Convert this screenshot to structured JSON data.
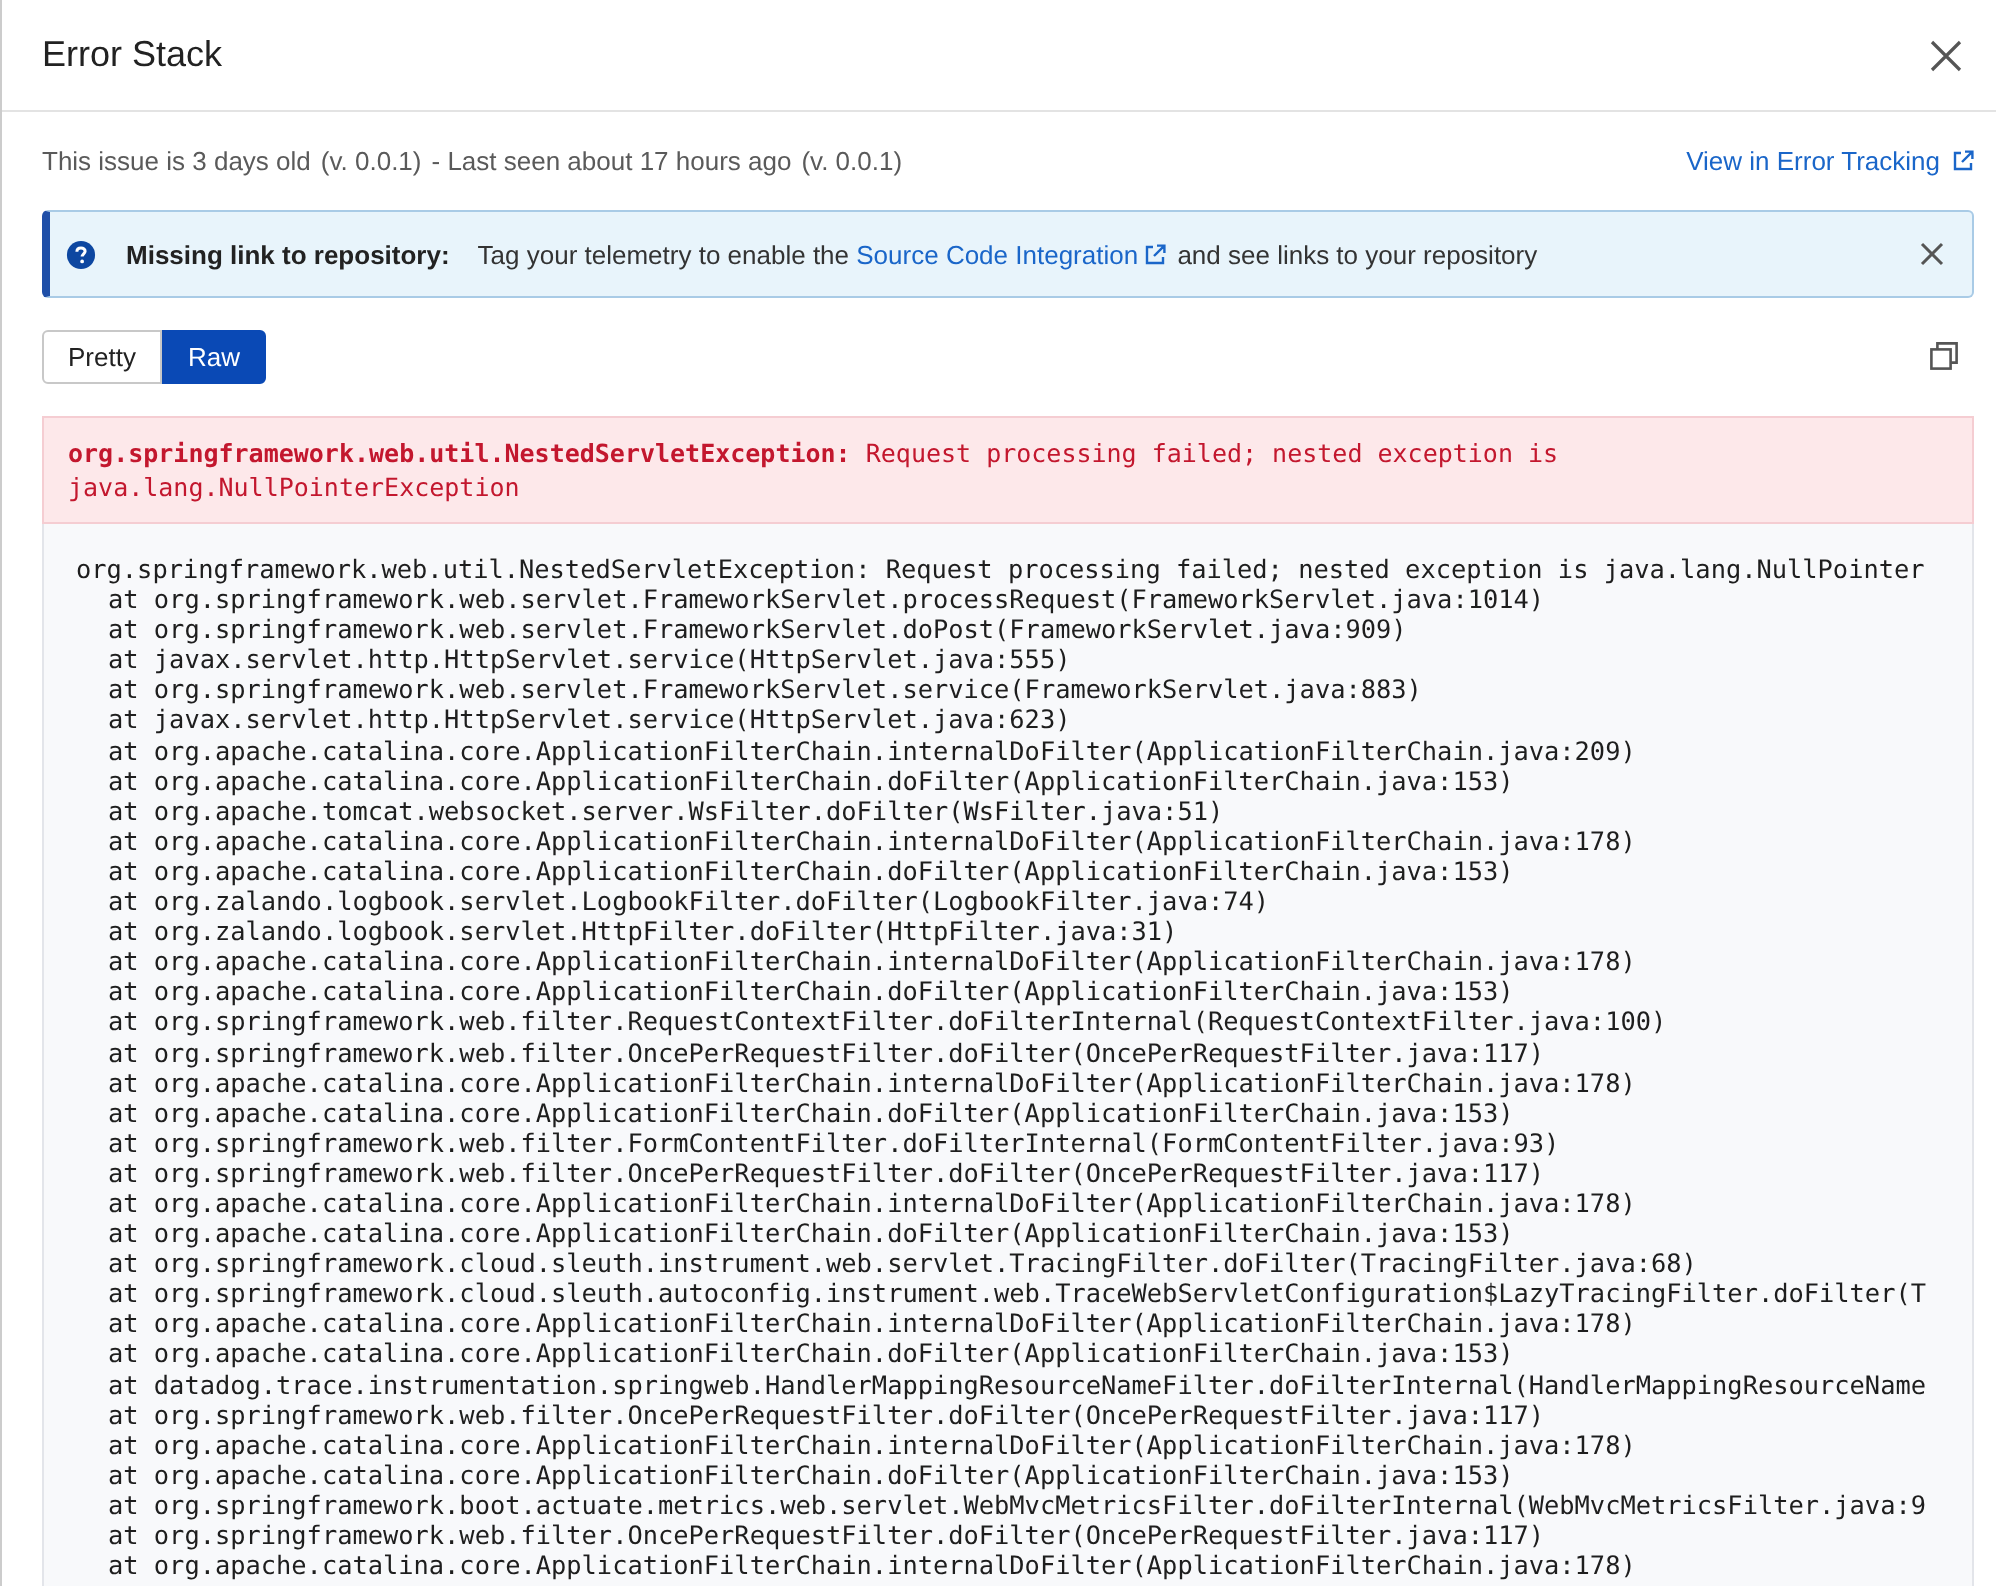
{
  "window": {
    "title": "Error Stack"
  },
  "meta": {
    "age": "This issue is 3 days old",
    "first_version": "(v. 0.0.1)",
    "last_seen": "- Last seen about 17 hours ago",
    "last_version": "(v. 0.0.1)",
    "link": "View in Error Tracking"
  },
  "banner": {
    "label": "Missing link to repository:",
    "text_before": "Tag your telemetry to enable the",
    "link": "Source Code Integration",
    "text_after": "and see links to your repository"
  },
  "view_toggle": [
    {
      "label": "Pretty",
      "selected": false
    },
    {
      "label": "Raw",
      "selected": true
    }
  ],
  "error": {
    "type": "org.springframework.web.util.NestedServletException:",
    "message": "Request processing failed; nested exception is java.lang.NullPointerException"
  },
  "stack_lines": [
    {
      "kind": "exception",
      "text": "org.springframework.web.util.NestedServletException: Request processing failed; nested exception is java.lang.NullPointer"
    },
    {
      "kind": "frame",
      "text": "at org.springframework.web.servlet.FrameworkServlet.processRequest(FrameworkServlet.java:1014)"
    },
    {
      "kind": "frame",
      "text": "at org.springframework.web.servlet.FrameworkServlet.doPost(FrameworkServlet.java:909)"
    },
    {
      "kind": "frame",
      "text": "at javax.servlet.http.HttpServlet.service(HttpServlet.java:555)"
    },
    {
      "kind": "frame",
      "text": "at org.springframework.web.servlet.FrameworkServlet.service(FrameworkServlet.java:883)"
    },
    {
      "kind": "frame",
      "text": "at javax.servlet.http.HttpServlet.service(HttpServlet.java:623)"
    },
    {
      "kind": "frame",
      "text": "at org.apache.catalina.core.ApplicationFilterChain.internalDoFilter(ApplicationFilterChain.java:209)"
    },
    {
      "kind": "frame",
      "text": "at org.apache.catalina.core.ApplicationFilterChain.doFilter(ApplicationFilterChain.java:153)"
    },
    {
      "kind": "frame",
      "text": "at org.apache.tomcat.websocket.server.WsFilter.doFilter(WsFilter.java:51)"
    },
    {
      "kind": "frame",
      "text": "at org.apache.catalina.core.ApplicationFilterChain.internalDoFilter(ApplicationFilterChain.java:178)"
    },
    {
      "kind": "frame",
      "text": "at org.apache.catalina.core.ApplicationFilterChain.doFilter(ApplicationFilterChain.java:153)"
    },
    {
      "kind": "frame",
      "text": "at org.zalando.logbook.servlet.LogbookFilter.doFilter(LogbookFilter.java:74)"
    },
    {
      "kind": "frame",
      "text": "at org.zalando.logbook.servlet.HttpFilter.doFilter(HttpFilter.java:31)"
    },
    {
      "kind": "frame",
      "text": "at org.apache.catalina.core.ApplicationFilterChain.internalDoFilter(ApplicationFilterChain.java:178)"
    },
    {
      "kind": "frame",
      "text": "at org.apache.catalina.core.ApplicationFilterChain.doFilter(ApplicationFilterChain.java:153)"
    },
    {
      "kind": "frame",
      "text": "at org.springframework.web.filter.RequestContextFilter.doFilterInternal(RequestContextFilter.java:100)"
    },
    {
      "kind": "frame",
      "text": "at org.springframework.web.filter.OncePerRequestFilter.doFilter(OncePerRequestFilter.java:117)"
    },
    {
      "kind": "frame",
      "text": "at org.apache.catalina.core.ApplicationFilterChain.internalDoFilter(ApplicationFilterChain.java:178)"
    },
    {
      "kind": "frame",
      "text": "at org.apache.catalina.core.ApplicationFilterChain.doFilter(ApplicationFilterChain.java:153)"
    },
    {
      "kind": "frame",
      "text": "at org.springframework.web.filter.FormContentFilter.doFilterInternal(FormContentFilter.java:93)"
    },
    {
      "kind": "frame",
      "text": "at org.springframework.web.filter.OncePerRequestFilter.doFilter(OncePerRequestFilter.java:117)"
    },
    {
      "kind": "frame",
      "text": "at org.apache.catalina.core.ApplicationFilterChain.internalDoFilter(ApplicationFilterChain.java:178)"
    },
    {
      "kind": "frame",
      "text": "at org.apache.catalina.core.ApplicationFilterChain.doFilter(ApplicationFilterChain.java:153)"
    },
    {
      "kind": "frame",
      "text": "at org.springframework.cloud.sleuth.instrument.web.servlet.TracingFilter.doFilter(TracingFilter.java:68)"
    },
    {
      "kind": "frame",
      "text": "at org.springframework.cloud.sleuth.autoconfig.instrument.web.TraceWebServletConfiguration$LazyTracingFilter.doFilter(T"
    },
    {
      "kind": "frame",
      "text": "at org.apache.catalina.core.ApplicationFilterChain.internalDoFilter(ApplicationFilterChain.java:178)"
    },
    {
      "kind": "frame",
      "text": "at org.apache.catalina.core.ApplicationFilterChain.doFilter(ApplicationFilterChain.java:153)"
    },
    {
      "kind": "frame",
      "text": "at datadog.trace.instrumentation.springweb.HandlerMappingResourceNameFilter.doFilterInternal(HandlerMappingResourceName"
    },
    {
      "kind": "frame",
      "text": "at org.springframework.web.filter.OncePerRequestFilter.doFilter(OncePerRequestFilter.java:117)"
    },
    {
      "kind": "frame",
      "text": "at org.apache.catalina.core.ApplicationFilterChain.internalDoFilter(ApplicationFilterChain.java:178)"
    },
    {
      "kind": "frame",
      "text": "at org.apache.catalina.core.ApplicationFilterChain.doFilter(ApplicationFilterChain.java:153)"
    },
    {
      "kind": "frame",
      "text": "at org.springframework.boot.actuate.metrics.web.servlet.WebMvcMetricsFilter.doFilterInternal(WebMvcMetricsFilter.java:9"
    },
    {
      "kind": "frame",
      "text": "at org.springframework.web.filter.OncePerRequestFilter.doFilter(OncePerRequestFilter.java:117)"
    },
    {
      "kind": "frame",
      "text": "at org.apache.catalina.core.ApplicationFilterChain.internalDoFilter(ApplicationFilterChain.java:178)"
    }
  ]
}
